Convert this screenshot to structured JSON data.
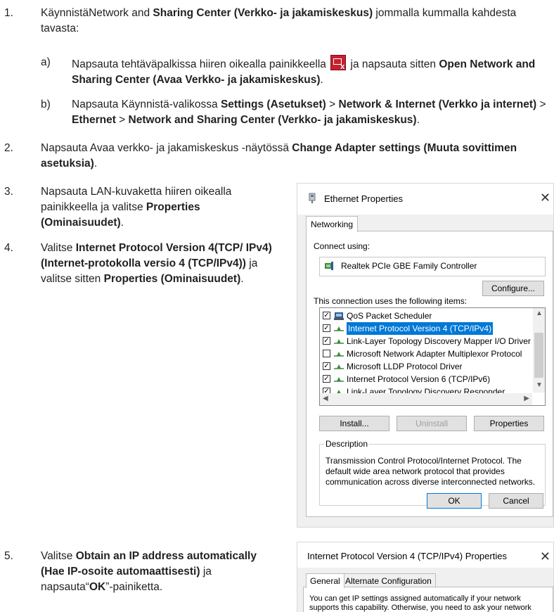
{
  "doc": {
    "s1": {
      "num": "1.",
      "pre": "KäynnistäNetwork and ",
      "b1": "Sharing Center (Verkko- ja jakamiskeskus)",
      "post": " jommalla kummalla kahdesta tavasta:"
    },
    "s1a": {
      "num": "a)",
      "pre": "Napsauta tehtäväpalkissa hiiren oikealla painikkeella ",
      "mid": " ja napsauta sitten ",
      "b1": "Open Network and Sharing Center (Avaa Verkko- ja jakamiskeskus)",
      "post": "."
    },
    "s1b": {
      "num": "b)",
      "pre": "Napsauta Käynnistä-valikossa ",
      "b1": "Settings (Asetukset)",
      "sep1": " > ",
      "b2": "Network & Internet (Verkko ja internet)",
      "sep2": " > ",
      "b3": "Ethernet",
      "sep3": " > ",
      "b4": "Network and Sharing Center (Verkko- ja jakamiskeskus)",
      "post": "."
    },
    "s2": {
      "num": "2.",
      "pre": "Napsauta Avaa verkko- ja jakamiskeskus -näytössä ",
      "b1": "Change Adapter settings (Muuta sovittimen asetuksia)",
      "post": "."
    },
    "s3": {
      "num": "3.",
      "pre": "Napsauta LAN-kuvaketta hiiren oikealla painikkeella ja valitse ",
      "b1": "Properties (Ominaisuudet)",
      "post": "."
    },
    "s4": {
      "num": "4.",
      "pre": "Valitse ",
      "b1": "Internet Protocol Version 4(TCP/ IPv4) (Internet-protokolla versio 4 (TCP/IPv4))",
      "mid": " ja valitse sitten ",
      "b2": "Properties (Ominaisuudet)",
      "post": "."
    },
    "s5": {
      "num": "5.",
      "pre": "Valitse ",
      "b1": "Obtain an IP address automatically (Hae IP-osoite automaattisesti)",
      "mid": " ja napsauta“",
      "b2": "OK",
      "post": "”-painiketta."
    }
  },
  "ethernet": {
    "title": "Ethernet Properties",
    "tab": "Networking",
    "connect_using": "Connect using:",
    "adapter": "Realtek PCIe GBE Family Controller",
    "configure": "Configure...",
    "items_label": "This connection uses the following items:",
    "items": [
      {
        "label": "QoS Packet Scheduler",
        "checked": true,
        "icon": "qos-icon"
      },
      {
        "label": "Internet Protocol Version 4 (TCP/IPv4)",
        "checked": true,
        "icon": "protocol-icon",
        "selected": true
      },
      {
        "label": "Link-Layer Topology Discovery Mapper I/O Driver",
        "checked": true,
        "icon": "protocol-icon"
      },
      {
        "label": "Microsoft Network Adapter Multiplexor Protocol",
        "checked": false,
        "icon": "protocol-icon"
      },
      {
        "label": "Microsoft LLDP Protocol Driver",
        "checked": true,
        "icon": "protocol-icon"
      },
      {
        "label": "Internet Protocol Version 6 (TCP/IPv6)",
        "checked": true,
        "icon": "protocol-icon"
      },
      {
        "label": "Link-Layer Topology Discovery Responder",
        "checked": true,
        "icon": "protocol-icon"
      }
    ],
    "install": "Install...",
    "uninstall": "Uninstall",
    "properties": "Properties",
    "description_title": "Description",
    "description": "Transmission Control Protocol/Internet Protocol. The default wide area network protocol that provides communication across diverse interconnected networks.",
    "ok": "OK",
    "cancel": "Cancel"
  },
  "ipv4": {
    "title": "Internet Protocol Version 4 (TCP/IPv4) Properties",
    "tab_general": "General",
    "tab_alternate": "Alternate Configuration",
    "text": "You can get IP settings assigned automatically if your network supports this capability. Otherwise, you need to ask your network administrator for the appropriate IP settings."
  }
}
